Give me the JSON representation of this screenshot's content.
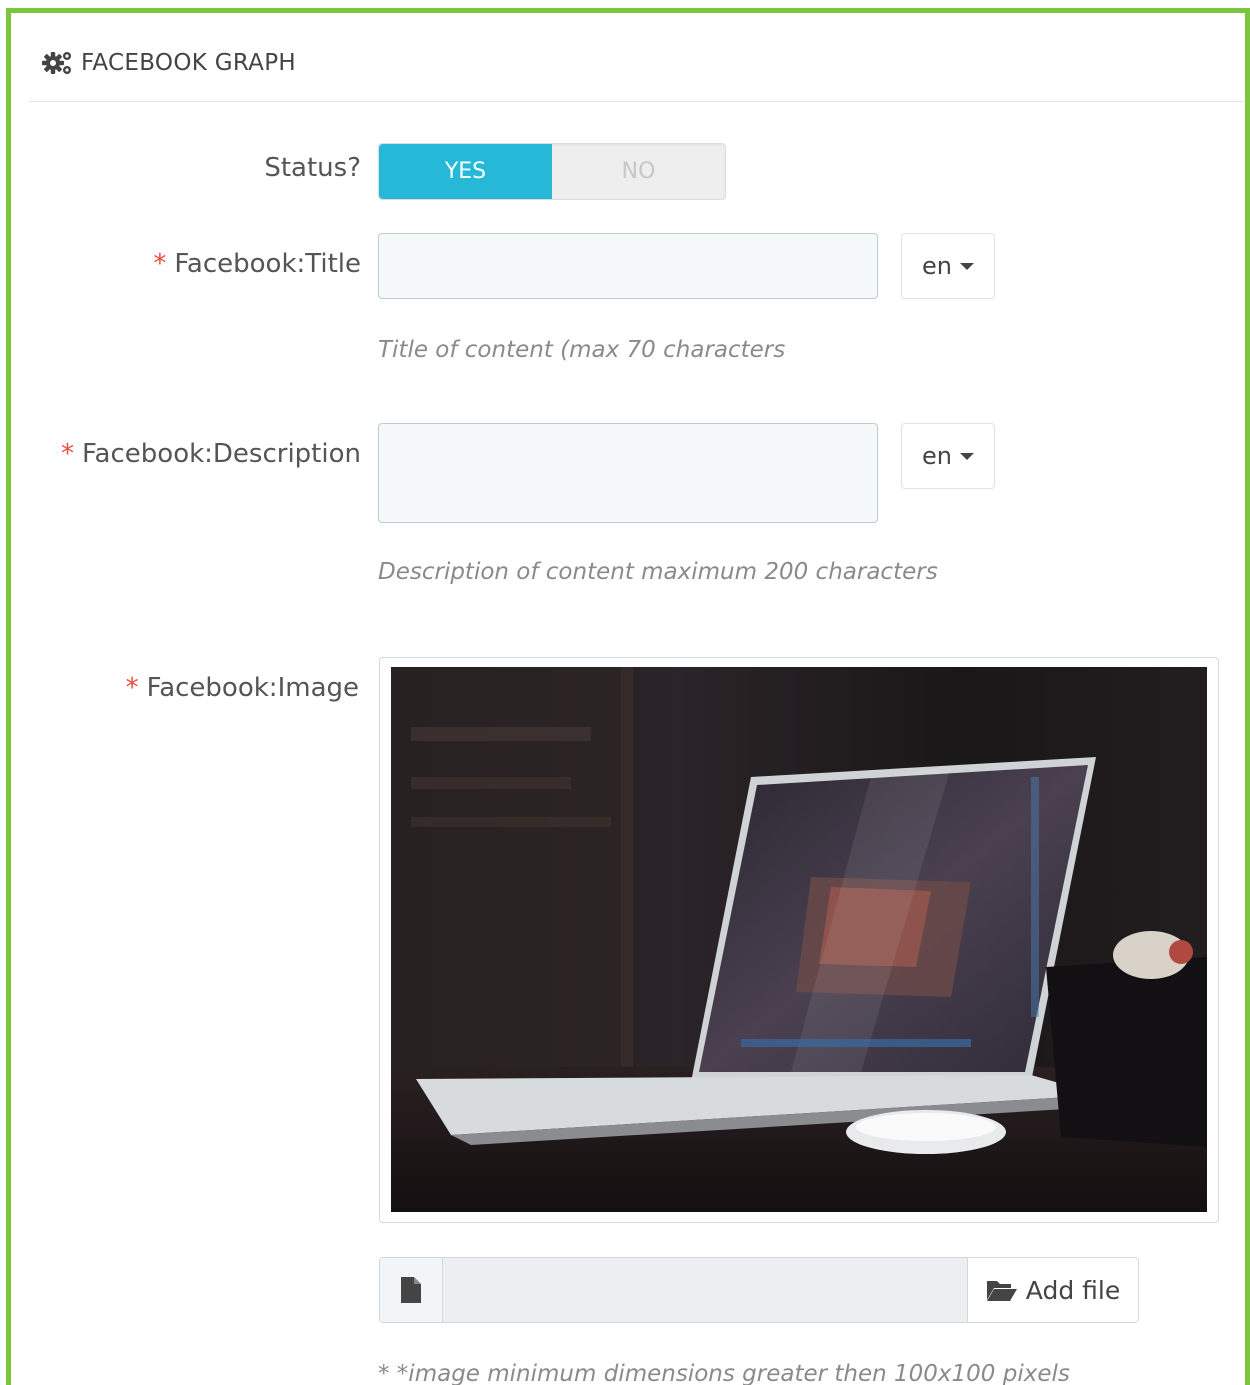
{
  "panel": {
    "title": "FACEBOOK GRAPH",
    "icon": "cogs-icon"
  },
  "status": {
    "label": "Status?",
    "yes_label": "YES",
    "no_label": "NO",
    "selected": "YES"
  },
  "title_field": {
    "required_mark": "*",
    "label": "Facebook:Title",
    "value": "",
    "language": "en",
    "help": "Title of content (max 70 characters"
  },
  "description_field": {
    "required_mark": "*",
    "label": "Facebook:Description",
    "value": "",
    "language": "en",
    "help": "Description of content maximum 200 characters"
  },
  "image_field": {
    "required_mark": "*",
    "label": "Facebook:Image",
    "preview_icon": "laptop-photo",
    "file_icon": "file-icon",
    "file_name": "",
    "add_button_icon": "folder-open-icon",
    "add_button_label": "Add file",
    "help": "* *image minimum dimensions greater then 100x100 pixels"
  },
  "colors": {
    "accent": "#25b9d7",
    "frame": "#7cc53f",
    "required": "#e84c3d"
  }
}
